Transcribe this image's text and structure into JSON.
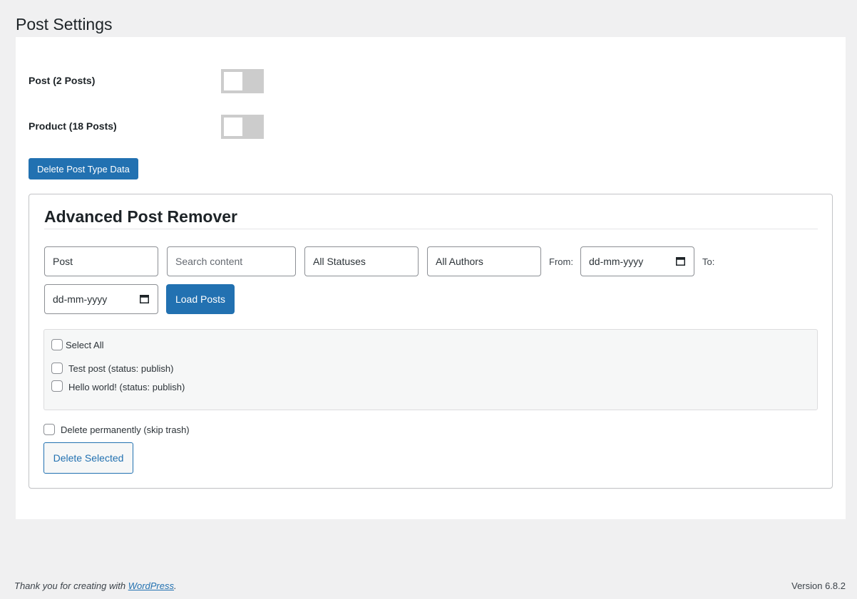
{
  "page": {
    "title": "Post Settings"
  },
  "post_types": [
    {
      "label": "Post (2 Posts)",
      "enabled": false
    },
    {
      "label": "Product (18 Posts)",
      "enabled": false
    }
  ],
  "delete_type_button": "Delete Post Type Data",
  "remover": {
    "title": "Advanced Post Remover",
    "filters": {
      "post_type_value": "Post",
      "search_placeholder": "Search content",
      "status_value": "All Statuses",
      "author_value": "All Authors",
      "from_label": "From:",
      "from_placeholder": "dd-mm-yyyy",
      "to_label": "To:",
      "to_placeholder": "dd-mm-yyyy"
    },
    "load_button": "Load Posts",
    "select_all_label": "Select All",
    "posts": [
      {
        "label": "Test post (status: publish)",
        "checked": false
      },
      {
        "label": "Hello world! (status: publish)",
        "checked": false
      }
    ],
    "delete_permanently_label": "Delete permanently (skip trash)",
    "delete_selected_button": "Delete Selected"
  },
  "footer": {
    "thank_you_prefix": "Thank you for creating with ",
    "wordpress_link": "WordPress",
    "thank_you_suffix": ".",
    "version": "Version 6.8.2"
  },
  "colors": {
    "primary": "#2271b1",
    "background": "#f0f0f1",
    "toggle_off": "#cccccc"
  }
}
